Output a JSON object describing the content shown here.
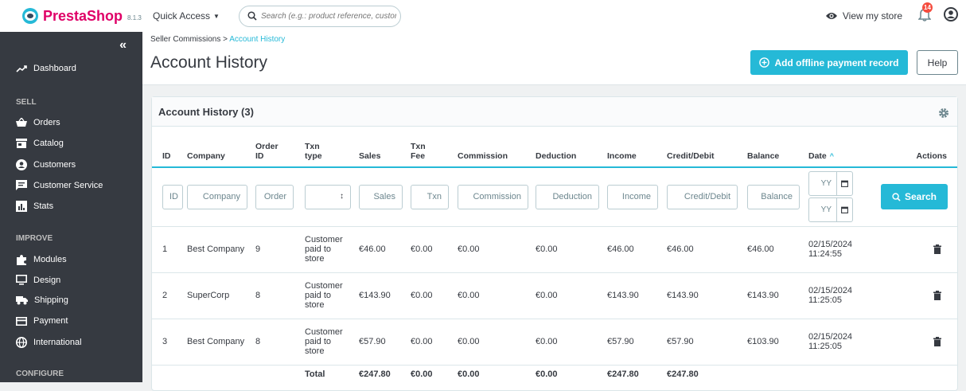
{
  "app": {
    "brand": "PrestaShop",
    "version": "8.1.3",
    "quick_access": "Quick Access",
    "search_placeholder": "Search (e.g.: product reference, custon",
    "view_store": "View my store",
    "notification_count": "14"
  },
  "sidebar": {
    "collapse": "«",
    "dashboard": "Dashboard",
    "sections": {
      "sell": "SELL",
      "improve": "IMPROVE",
      "configure": "CONFIGURE"
    },
    "sell_items": [
      "Orders",
      "Catalog",
      "Customers",
      "Customer Service",
      "Stats"
    ],
    "improve_items": [
      "Modules",
      "Design",
      "Shipping",
      "Payment",
      "International"
    ]
  },
  "header": {
    "breadcrumb_parent": "Seller Commissions",
    "breadcrumb_sep": ">",
    "breadcrumb_current": "Account History",
    "title": "Account History",
    "add_button": "Add offline payment record",
    "help_button": "Help"
  },
  "panel": {
    "title": "Account History (3)"
  },
  "table": {
    "columns": [
      "ID",
      "Company",
      "Order ID",
      "Txn type",
      "Sales",
      "Txn Fee",
      "Commission",
      "Deduction",
      "Income",
      "Credit/Debit",
      "Balance",
      "Date",
      "Actions"
    ],
    "column_lines": {
      "order_id": [
        "Order",
        "ID"
      ],
      "txn_type": [
        "Txn",
        "type"
      ],
      "txn_fee": [
        "Txn",
        "Fee"
      ]
    },
    "sort_indicator": "^",
    "filters": {
      "id": "ID",
      "company": "Company",
      "order_id": "Order",
      "sales": "Sales",
      "txn_fee": "Txn",
      "commission": "Commission",
      "deduction": "Deduction",
      "income": "Income",
      "credit_debit": "Credit/Debit",
      "balance": "Balance",
      "date_from": "YY",
      "date_to": "YY"
    },
    "search_button": "Search",
    "rows": [
      {
        "id": "1",
        "company": "Best Company",
        "order_id": "9",
        "txn_type": [
          "Customer",
          "paid to",
          "store"
        ],
        "sales": "€46.00",
        "txn_fee": "€0.00",
        "commission": "€0.00",
        "deduction": "€0.00",
        "income": "€46.00",
        "credit_debit": "€46.00",
        "balance": "€46.00",
        "date": [
          "02/15/2024",
          "11:24:55"
        ]
      },
      {
        "id": "2",
        "company": "SuperCorp",
        "order_id": "8",
        "txn_type": [
          "Customer",
          "paid to",
          "store"
        ],
        "sales": "€143.90",
        "txn_fee": "€0.00",
        "commission": "€0.00",
        "deduction": "€0.00",
        "income": "€143.90",
        "credit_debit": "€143.90",
        "balance": "€143.90",
        "date": [
          "02/15/2024",
          "11:25:05"
        ]
      },
      {
        "id": "3",
        "company": "Best Company",
        "order_id": "8",
        "txn_type": [
          "Customer",
          "paid to",
          "store"
        ],
        "sales": "€57.90",
        "txn_fee": "€0.00",
        "commission": "€0.00",
        "deduction": "€0.00",
        "income": "€57.90",
        "credit_debit": "€57.90",
        "balance": "€103.90",
        "date": [
          "02/15/2024",
          "11:25:05"
        ]
      }
    ],
    "total": {
      "label": "Total",
      "sales": "€247.80",
      "txn_fee": "€0.00",
      "commission": "€0.00",
      "deduction": "€0.00",
      "income": "€247.80",
      "credit_debit": "€247.80"
    }
  },
  "colors": {
    "accent": "#25b9d7",
    "brand": "#df0067",
    "sidebar_bg": "#363a41",
    "badge": "#f54c3e"
  }
}
